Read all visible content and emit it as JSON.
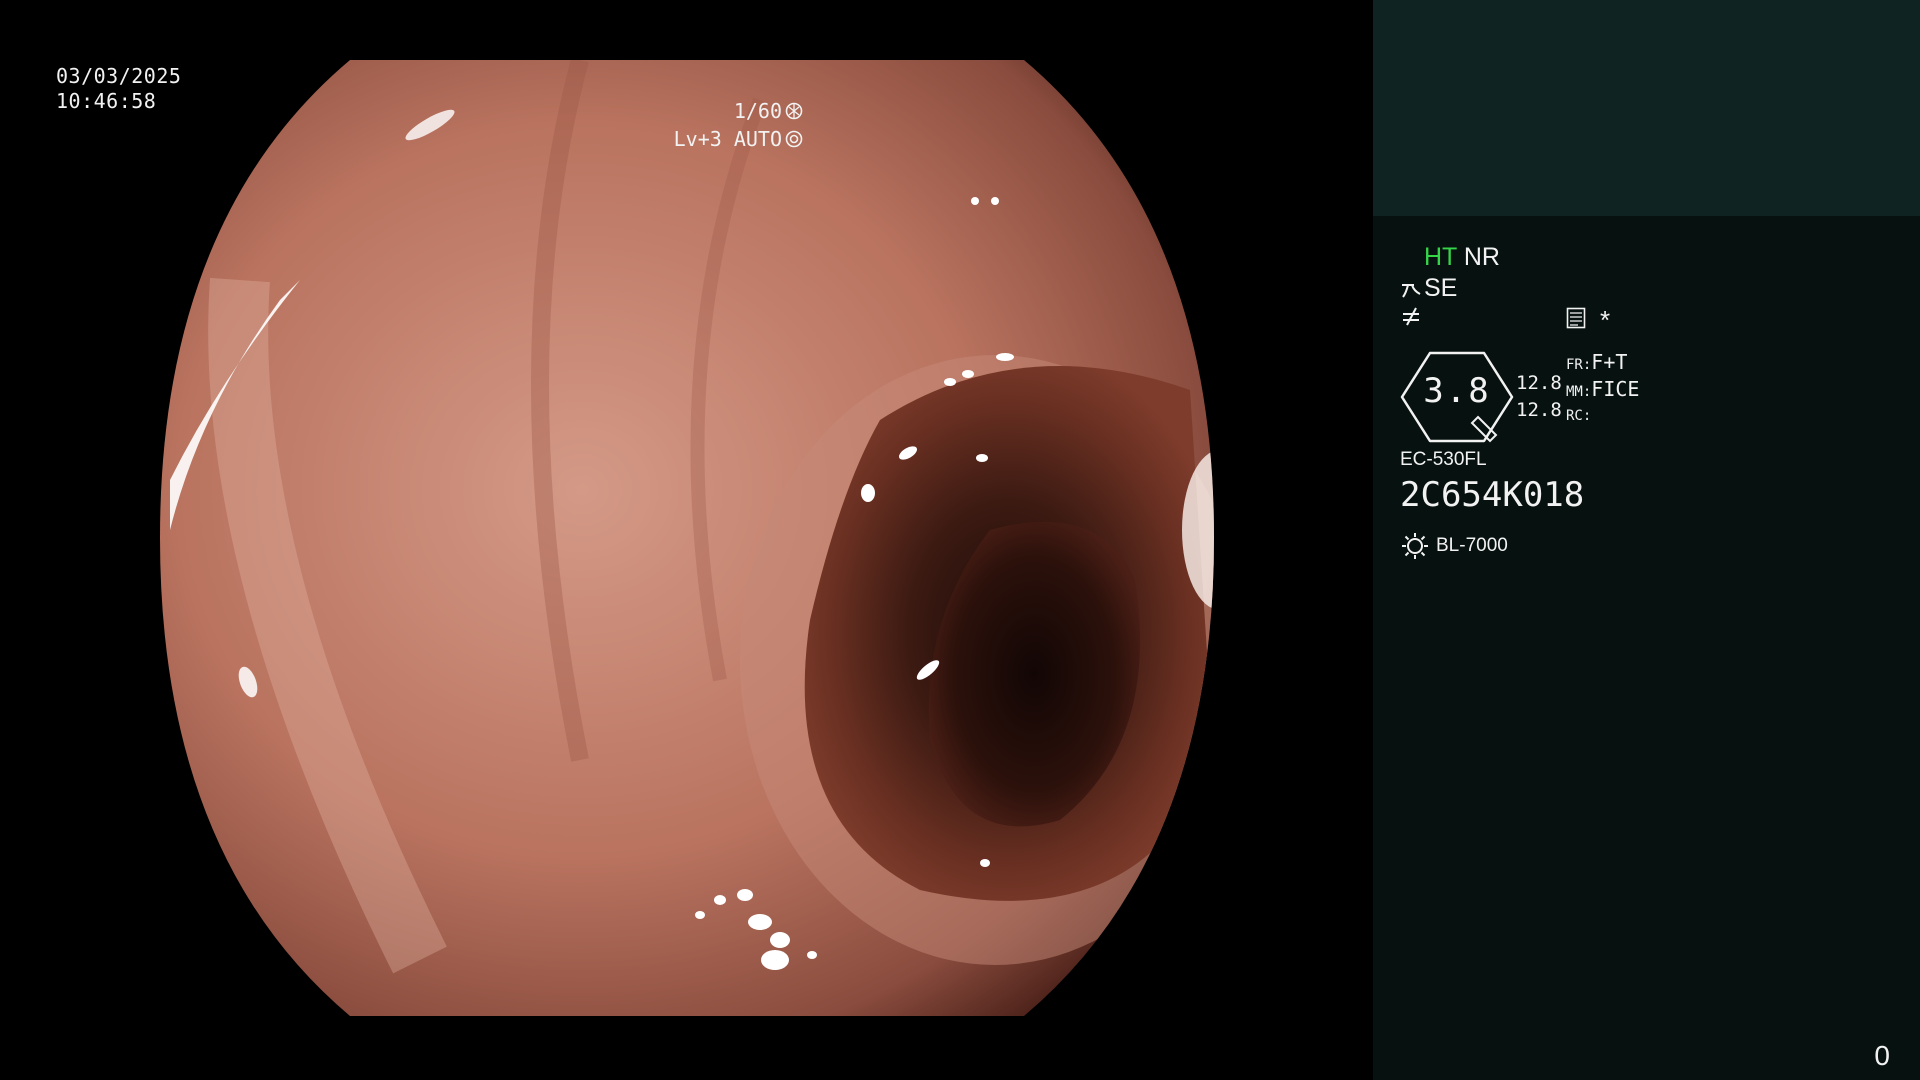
{
  "overlay": {
    "date": "03/03/2025",
    "time": "10:46:58",
    "shutter": "1/60",
    "level": "Lv+3 AUTO"
  },
  "panel": {
    "ht": "HT",
    "nr": "NR",
    "se": "SE",
    "star": "*",
    "gauge_value": "3.8",
    "values": [
      "12.8",
      "12.8"
    ],
    "fr_key": "FR:",
    "fr_value": "F+T",
    "mm_key": "MM:",
    "mm_value": "FICE",
    "rc_key": "RC:",
    "scope_model": "EC-530FL",
    "scope_serial": "2C654K018",
    "light_source": "BL-7000",
    "counter": "0"
  },
  "colors": {
    "panel_bg": "#071210",
    "panel_top": "#0f2422",
    "ht_highlight": "#35d54a"
  }
}
